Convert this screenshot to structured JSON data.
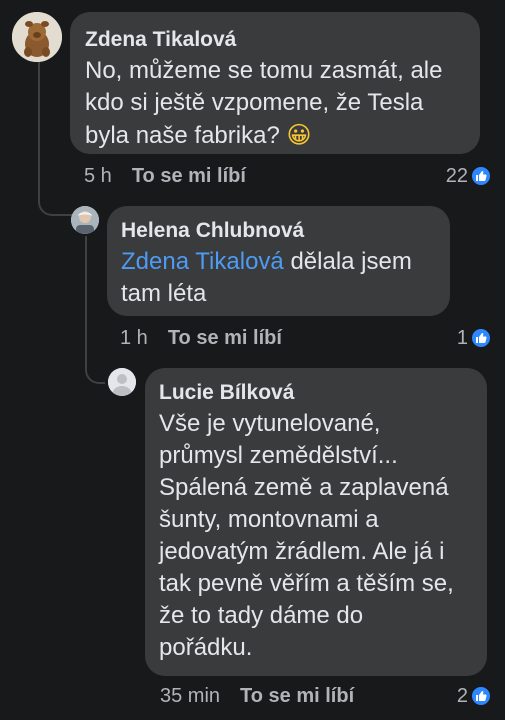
{
  "comments": [
    {
      "author": "Zdena Tikalová",
      "text": "No, můžeme se tomu zasmát, ale kdo si ještě vzpomene, že Tesla byla naše fabrika?",
      "emoji": "😀",
      "time": "5 h",
      "like_label": "To se mi líbí",
      "reaction_count": "22"
    },
    {
      "author": "Helena Chlubnová",
      "mention": "Zdena Tikalová",
      "text": "dělala jsem tam léta",
      "time": "1 h",
      "like_label": "To se mi líbí",
      "reaction_count": "1"
    },
    {
      "author": "Lucie Bílková",
      "text": "Vše je vytunelované, průmysl zemědělství... Spálená země a zaplavená šunty, montovnami a jedovatým žrádlem. Ale já i tak pevně věřím a těším se, že to tady dáme do pořádku.",
      "time": "35 min",
      "like_label": "To se mi líbí",
      "reaction_count": "2"
    }
  ],
  "colors": {
    "background": "#18191a",
    "bubble": "#3a3b3c",
    "mention": "#4e9bf3",
    "like_badge": "#2d88ff"
  },
  "icons": [
    "avatar-plush-toy",
    "avatar-portrait",
    "avatar-placeholder",
    "thumbs-up-icon"
  ]
}
